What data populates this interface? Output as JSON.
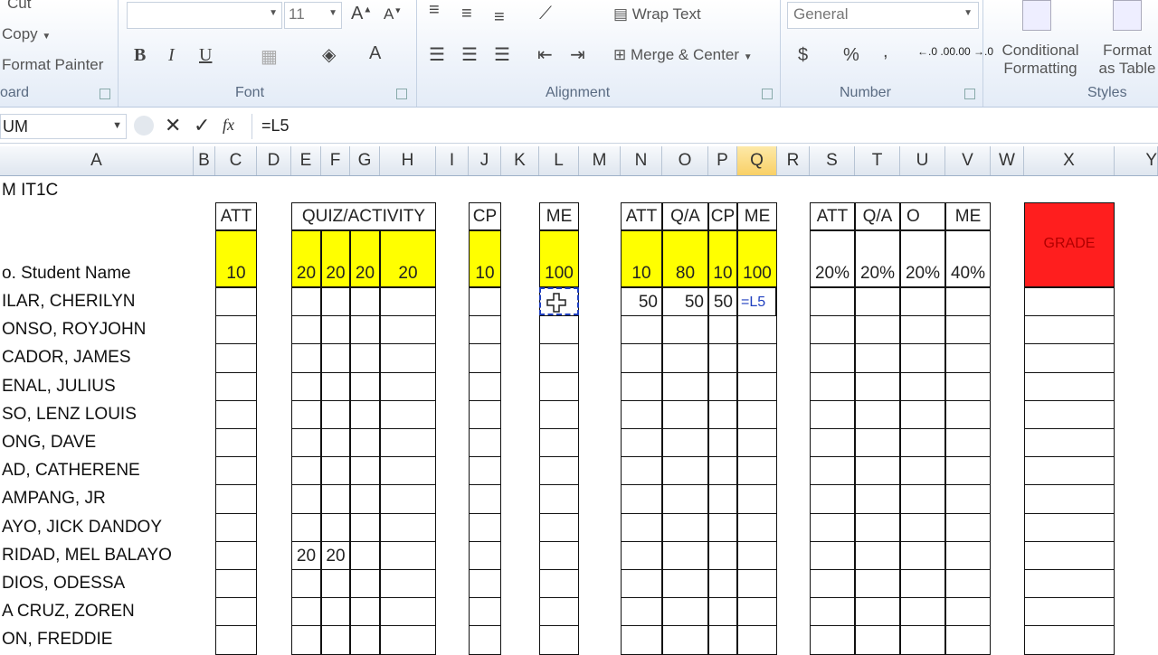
{
  "clipboard": {
    "cut": "Cut",
    "copy": "Copy",
    "format_painter": "Format Painter",
    "group": "oard"
  },
  "font": {
    "size": "11",
    "bold": "B",
    "italic": "I",
    "underline": "U",
    "group": "Font"
  },
  "alignment": {
    "wrap_text": "Wrap Text",
    "merge_center": "Merge & Center",
    "group": "Alignment"
  },
  "number": {
    "format": "General",
    "dollar": "$",
    "percent": "%",
    "comma": ",",
    "inc_decimal": "←.0 .00",
    "dec_decimal": ".00 →.0",
    "group": "Number"
  },
  "styles": {
    "conditional_1": "Conditional",
    "conditional_2": "Formatting",
    "table_1": "Format",
    "table_2": "as Table",
    "group": "Styles"
  },
  "formula_bar": {
    "name_box": "UM",
    "cancel": "✕",
    "enter": "✓",
    "fx": "fx",
    "formula": "=L5"
  },
  "columns": [
    "A",
    "B",
    "C",
    "D",
    "E",
    "F",
    "G",
    "H",
    "I",
    "J",
    "K",
    "L",
    "M",
    "N",
    "O",
    "P",
    "Q",
    "R",
    "S",
    "T",
    "U",
    "V",
    "W",
    "X",
    "Y"
  ],
  "sheet": {
    "title": "M IT1C",
    "headers": {
      "att": "ATT",
      "quiz": "QUIZ/ACTIVITY",
      "cp": "CP",
      "me": "ME",
      "att2": "ATT",
      "qa": "Q/A",
      "cp2": "CP",
      "me2": "ME",
      "att3": "ATT",
      "qa2": "Q/A",
      "o": "O",
      "me3": "ME",
      "grade": "GRADE"
    },
    "name_header": "o.   Student Name",
    "max_scores": {
      "c": "10",
      "e": "20",
      "f": "20",
      "g": "20",
      "h": "20",
      "j": "10",
      "l": "100",
      "n": "10",
      "o": "80",
      "p": "10",
      "q": "100",
      "s": "20%",
      "t": "20%",
      "u": "20%",
      "v": "40%"
    },
    "students": [
      "ILAR, CHERILYN",
      "ONSO, ROYJOHN",
      "CADOR, JAMES",
      "ENAL, JULIUS",
      "SO, LENZ LOUIS",
      "ONG, DAVE",
      "AD, CATHERENE",
      "AMPANG, JR",
      "AYO, JICK DANDOY",
      "RIDAD, MEL BALAYO",
      "DIOS, ODESSA",
      "A CRUZ, ZOREN",
      "ON, FREDDIE"
    ],
    "row1_values": {
      "n": "50",
      "o": "50",
      "p": "50",
      "q": "=L5"
    },
    "row10_values": {
      "e": "20",
      "f": "20"
    }
  },
  "colors": {
    "highlight": "#ffff00",
    "grade": "#ff1e1e",
    "selected_col": "#f9d066"
  }
}
